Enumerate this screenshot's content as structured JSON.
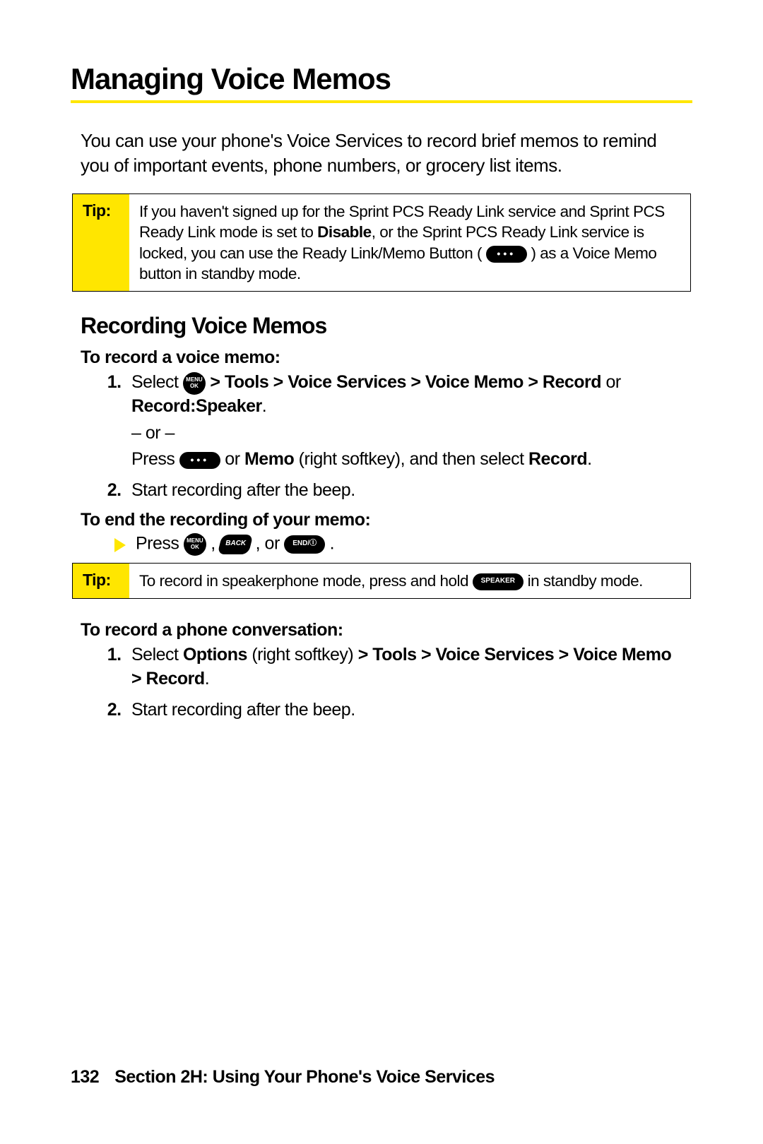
{
  "title": "Managing Voice Memos",
  "intro": "You can use your phone's Voice Services to record brief memos to remind you of important events, phone numbers, or grocery list items.",
  "tip1": {
    "label": "Tip:",
    "p1a": "If you haven't signed up for the Sprint PCS Ready Link service and Sprint PCS Ready Link mode is set to ",
    "disable": "Disable",
    "p1b": ", or the Sprint PCS Ready Link service is locked, you can use the Ready Link/Memo Button ( ",
    "p1c": " ) as a Voice Memo button in standby mode."
  },
  "subhead": "Recording Voice Memos",
  "rec": {
    "lead": "To record a voice memo:",
    "s1a": "Select ",
    "s1_nav": " > Tools > Voice Services > Voice Memo > Record",
    "s1_or_word": " or ",
    "s1_rec_spk": "Record:Speaker",
    "s1_period": ".",
    "or": "– or –",
    "s1b_a": "Press ",
    "s1b_b": " or ",
    "s1b_memo": "Memo",
    "s1b_c": " (right softkey), and then select ",
    "s1b_record": "Record",
    "s1b_d": ".",
    "s2": "Start recording after the beep."
  },
  "end": {
    "lead": "To end the recording of your memo:",
    "press": "Press ",
    "comma": " , ",
    "or": " , or ",
    "period": " ."
  },
  "tip2": {
    "label": "Tip:",
    "a": "To record in speakerphone mode, press and hold ",
    "b": " in standby mode."
  },
  "conv": {
    "lead": "To record a phone conversation:",
    "s1a": "Select ",
    "s1_options": "Options",
    "s1b": " (right softkey) ",
    "s1_nav": "> Tools > Voice Services > Voice Memo > Record",
    "s1c": ".",
    "s2": "Start recording after the beep."
  },
  "footer": {
    "page": "132",
    "section": "Section 2H: Using Your Phone's Voice Services"
  },
  "icons": {
    "menu_top": "MENU",
    "menu_bot": "OK",
    "dots": "•••",
    "back": "BACK",
    "end": "END/Ⓘ",
    "speaker": "SPEAKER"
  }
}
